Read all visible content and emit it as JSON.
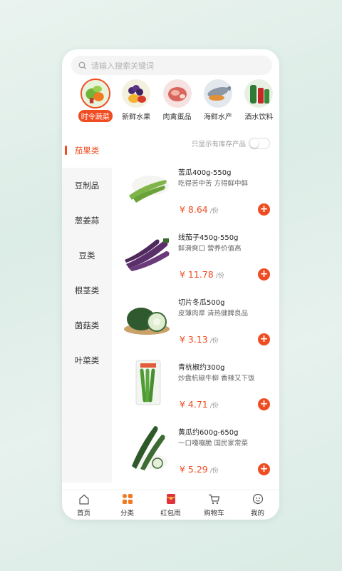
{
  "search": {
    "placeholder": "请输入搜索关键词"
  },
  "categories": [
    {
      "label": "时令蔬菜",
      "icon": "vegetables-icon",
      "active": true
    },
    {
      "label": "新鲜水果",
      "icon": "fruits-icon"
    },
    {
      "label": "肉禽蛋品",
      "icon": "meat-icon"
    },
    {
      "label": "海鲜水产",
      "icon": "seafood-icon"
    },
    {
      "label": "酒水饮料",
      "icon": "drinks-icon"
    }
  ],
  "sidebar": {
    "items": [
      {
        "label": "茄果类",
        "active": true
      },
      {
        "label": "豆制品"
      },
      {
        "label": "葱姜蒜"
      },
      {
        "label": "豆类"
      },
      {
        "label": "根茎类"
      },
      {
        "label": "菌菇类"
      },
      {
        "label": "叶菜类"
      }
    ]
  },
  "filter": {
    "stock_only_label": "只显示有库存产品"
  },
  "products": [
    {
      "name": "苦瓜400g-550g",
      "desc": "吃得苦中苦 方得鲜中鲜",
      "price": "¥ 8.64",
      "unit": "/份",
      "image": "bitter-melon-icon"
    },
    {
      "name": "线茄子450g-550g",
      "desc": "鲜滑爽口 营养价值高",
      "price": "¥ 11.78",
      "unit": "/份",
      "image": "eggplant-icon"
    },
    {
      "name": "切片冬瓜500g",
      "desc": "皮薄肉厚 清热健脾良品",
      "price": "¥ 3.13",
      "unit": "/份",
      "image": "winter-melon-icon"
    },
    {
      "name": "青杭椒约300g",
      "desc": "炒盘杭椒牛柳 香辣又下饭",
      "price": "¥ 4.71",
      "unit": "/份",
      "image": "green-pepper-icon"
    },
    {
      "name": "黄瓜约600g-650g",
      "desc": "一口嘎嘣脆 国民家常菜",
      "price": "¥ 5.29",
      "unit": "/份",
      "image": "cucumber-icon"
    }
  ],
  "tabbar": [
    {
      "label": "首页",
      "icon": "home-icon"
    },
    {
      "label": "分类",
      "icon": "category-icon",
      "active": true
    },
    {
      "label": "红包雨",
      "icon": "red-envelope-icon"
    },
    {
      "label": "购物车",
      "icon": "cart-icon"
    },
    {
      "label": "我的",
      "icon": "profile-icon"
    }
  ],
  "colors": {
    "accent": "#f04c22",
    "background": "#e4f0eb"
  }
}
